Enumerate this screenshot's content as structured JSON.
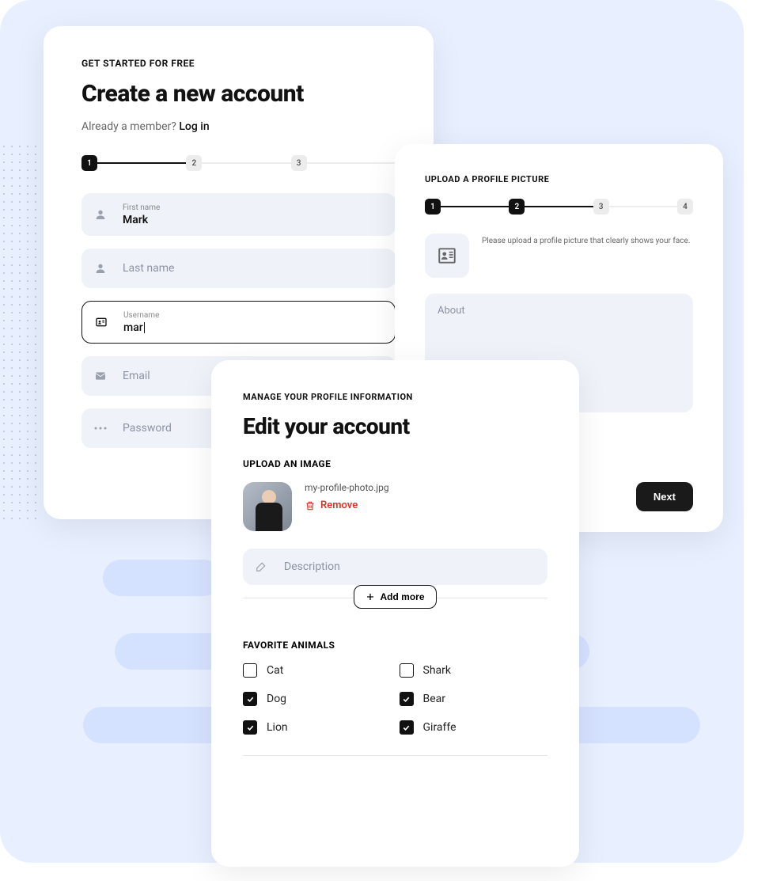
{
  "card1": {
    "overline": "GET STARTED FOR FREE",
    "title": "Create a new account",
    "member_text": "Already a member? ",
    "login_text": "Log in",
    "steps": [
      "1",
      "2",
      "3"
    ],
    "first_name_label": "First name",
    "first_name_value": "Mark",
    "last_name_placeholder": "Last name",
    "username_label": "Username",
    "username_value": "mar",
    "email_placeholder": "Email",
    "password_placeholder": "Password"
  },
  "card2": {
    "overline": "UPLOAD A PROFILE PICTURE",
    "steps": [
      "1",
      "2",
      "3",
      "4"
    ],
    "hint": "Please upload a profile picture that clearly shows your face.",
    "about_placeholder": "About",
    "next_label": "Next"
  },
  "card3": {
    "overline": "MANAGE YOUR PROFILE INFORMATION",
    "title": "Edit your account",
    "upload_section": "UPLOAD AN IMAGE",
    "filename": "my-profile-photo.jpg",
    "remove_label": "Remove",
    "description_placeholder": "Description",
    "add_more_label": "Add more",
    "fav_section": "FAVORITE ANIMALS",
    "animals": [
      {
        "label": "Cat",
        "checked": false
      },
      {
        "label": "Shark",
        "checked": false
      },
      {
        "label": "Dog",
        "checked": true
      },
      {
        "label": "Bear",
        "checked": true
      },
      {
        "label": "Lion",
        "checked": true
      },
      {
        "label": "Giraffe",
        "checked": true
      }
    ]
  }
}
